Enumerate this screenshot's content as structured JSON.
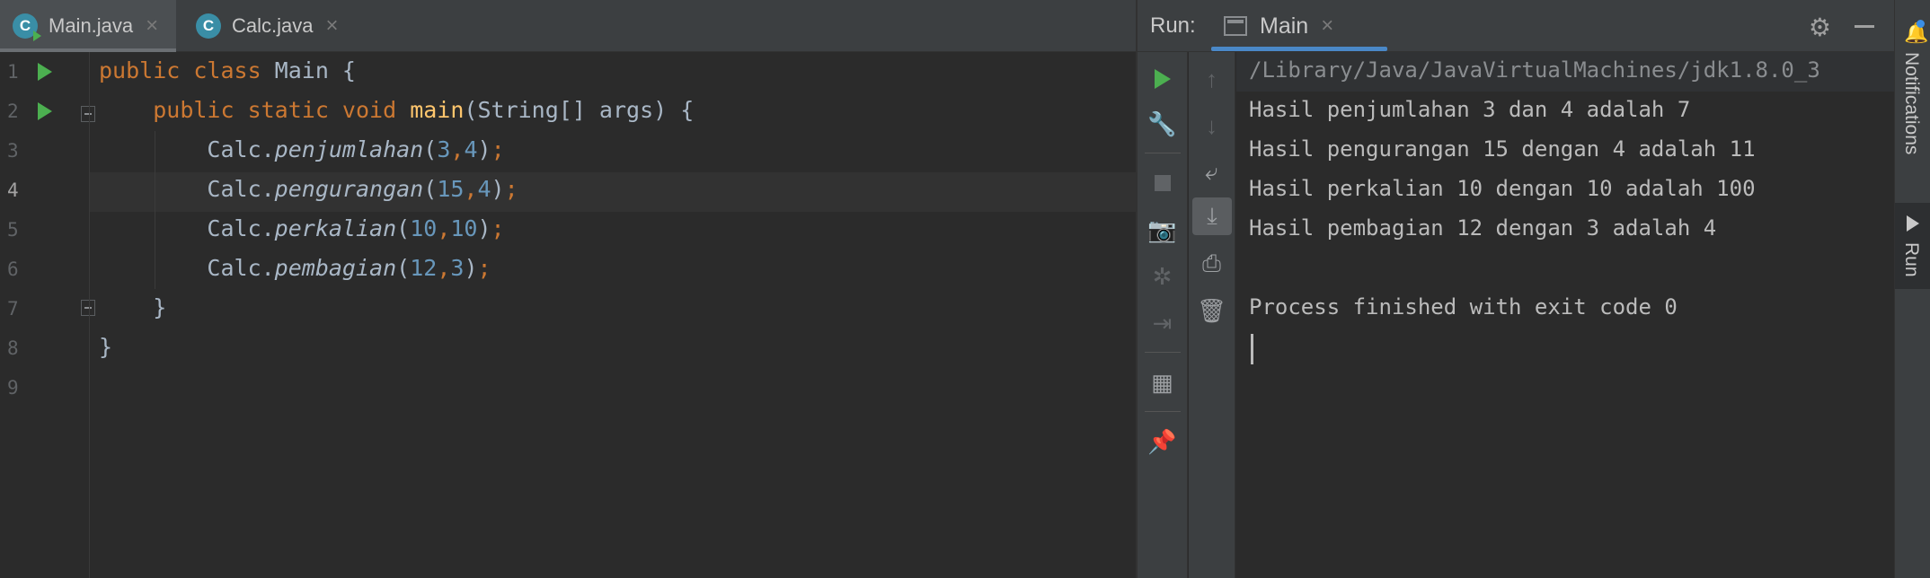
{
  "editor": {
    "tabs": [
      {
        "label": "Main.java",
        "icon": "C",
        "active": true
      },
      {
        "label": "Calc.java",
        "icon": "C",
        "active": false
      }
    ],
    "line_numbers": [
      "1",
      "2",
      "3",
      "4",
      "5",
      "6",
      "7",
      "8",
      "9"
    ],
    "current_line": 4
  },
  "run_panel": {
    "label": "Run:",
    "tab_label": "Main",
    "console_lines": [
      "/Library/Java/JavaVirtualMachines/jdk1.8.0_3",
      "Hasil penjumlahan 3 dan 4 adalah 7",
      "Hasil pengurangan 15 dengan 4 adalah 11",
      "Hasil perkalian 10 dengan 10 adalah 100",
      "Hasil pembagian 12 dengan 3 adalah 4",
      "",
      "Process finished with exit code 0"
    ]
  },
  "right_strip": {
    "notifications_label": "Notifications",
    "run_label": "Run"
  },
  "colors": {
    "accent": "#4a88c7",
    "run_green": "#4caf50",
    "keyword": "#cc7832",
    "number": "#6897bb",
    "method": "#ffc66d"
  }
}
